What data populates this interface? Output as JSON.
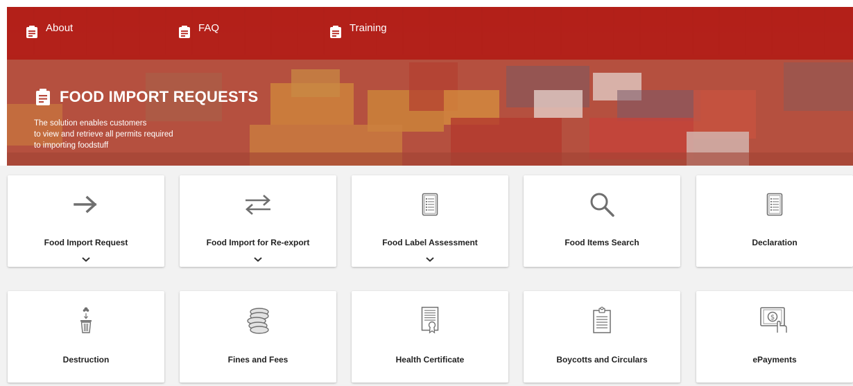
{
  "nav": {
    "items": [
      {
        "label": "About",
        "icon": "clipboard-icon"
      },
      {
        "label": "FAQ",
        "icon": "clipboard-icon"
      },
      {
        "label": "Training",
        "icon": "clipboard-icon"
      }
    ]
  },
  "hero": {
    "title": "FOOD IMPORT REQUESTS",
    "description": [
      "The solution enables customers",
      "to view and retrieve all permits required",
      "to importing foodstuff"
    ]
  },
  "colors": {
    "topbar": "#b21a14",
    "accent_icon": "#777777",
    "card_bg": "#ffffff",
    "page_bg": "#f2f2f2"
  },
  "services": {
    "row1": [
      {
        "label": "Food Import Request",
        "icon": "arrow-right-icon",
        "expandable": true
      },
      {
        "label": "Food Import for Re-export",
        "icon": "exchange-arrows-icon",
        "expandable": true
      },
      {
        "label": "Food Label Assessment",
        "icon": "document-list-icon",
        "expandable": true
      },
      {
        "label": "Food Items Search",
        "icon": "search-icon",
        "expandable": false
      },
      {
        "label": "Declaration",
        "icon": "document-list-icon",
        "expandable": false
      }
    ],
    "row2": [
      {
        "label": "Destruction",
        "icon": "trash-bin-icon"
      },
      {
        "label": "Fines and Fees",
        "icon": "coins-icon"
      },
      {
        "label": "Health Certificate",
        "icon": "certificate-icon"
      },
      {
        "label": "Boycotts and Circulars",
        "icon": "clipboard-list-icon"
      },
      {
        "label": "ePayments",
        "icon": "payment-screen-icon"
      }
    ]
  }
}
